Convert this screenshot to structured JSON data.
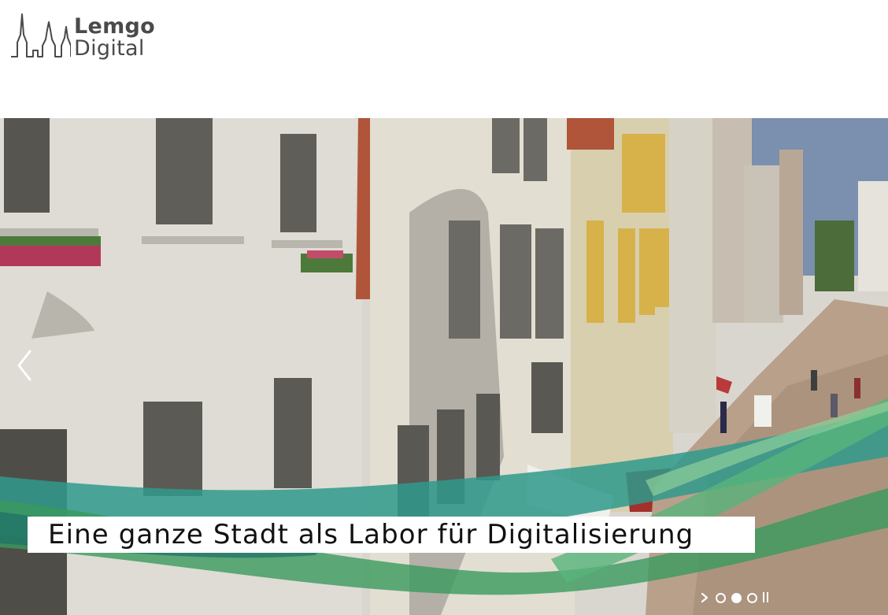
{
  "logo": {
    "line1": "Lemgo",
    "line2": "Digital"
  },
  "hero": {
    "caption": "Eine ganze Stadt als Labor für Digitalisierung",
    "slides_total": 3,
    "active_slide": 2
  },
  "icons": {
    "prev": "chevron-left-icon",
    "next": "chevron-right-icon",
    "pause": "pause-icon"
  },
  "colors": {
    "text_dark": "#4a4a4a",
    "ribbon_teal": "#2f9a8c",
    "ribbon_green": "#3a9a5e",
    "ribbon_dark": "#1f6e6a"
  }
}
